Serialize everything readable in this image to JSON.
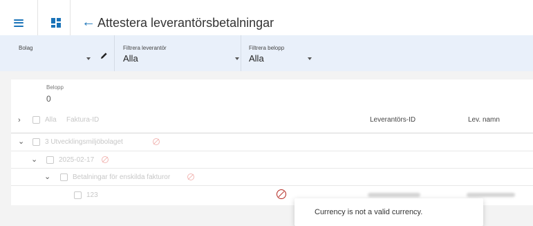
{
  "header": {
    "title": "Attestera leverantörsbetalningar"
  },
  "filters": {
    "bolag": {
      "label": "Bolag",
      "value": ""
    },
    "leverantor": {
      "label": "Filtrera leverantör",
      "value": "Alla"
    },
    "belopp": {
      "label": "Filtrera belopp",
      "value": "Alla"
    }
  },
  "summary": {
    "belopp_label": "Belopp",
    "belopp_value": "0"
  },
  "table": {
    "columns": {
      "alla": "Alla",
      "faktura_id": "Faktura-ID",
      "leverantors_id": "Leverantörs-ID",
      "lev_namn": "Lev. namn"
    },
    "groups": {
      "company": "3 Utvecklingsmiljöbolaget",
      "date": "2025-02-17",
      "type": "Betalningar för enskilda fakturor",
      "invoice_id": "123"
    }
  },
  "tooltip": {
    "message": "Currency is not a valid currency."
  },
  "colors": {
    "accent": "#1a73b8",
    "filter_bg": "#e9f0fa",
    "error": "#b3261e",
    "muted_icon": "#f2b8b5"
  }
}
